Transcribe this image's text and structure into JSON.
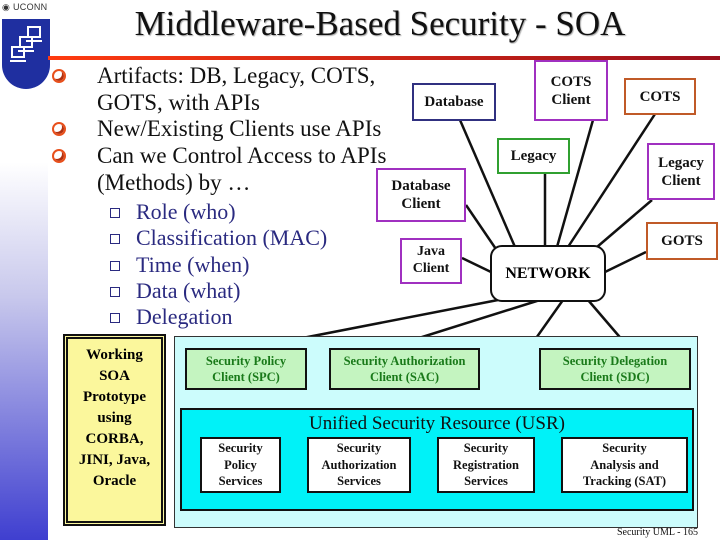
{
  "slide": {
    "title": "Middleware-Based Security - SOA",
    "logo_text": "UCONN",
    "footer": "Security UML - 165"
  },
  "bullets": [
    {
      "lines": [
        "Artifacts: DB, Legacy, COTS,",
        "GOTS, with APIs"
      ]
    },
    {
      "lines": [
        "New/Existing Clients use APIs"
      ]
    },
    {
      "lines": [
        "Can we Control Access to APIs",
        "(Methods) by …"
      ]
    }
  ],
  "sub_bullets": [
    "Role (who)",
    "Classification (MAC)",
    "Time (when)",
    "Data (what)",
    "Delegation"
  ],
  "network_diagram": {
    "center": "NETWORK",
    "nodes": [
      {
        "id": "database",
        "lines": [
          "Database"
        ],
        "color": "#303080"
      },
      {
        "id": "cots-client",
        "lines": [
          "COTS",
          "Client"
        ],
        "color": "#a030c0"
      },
      {
        "id": "cots",
        "lines": [
          "COTS"
        ],
        "color": "#c05a28"
      },
      {
        "id": "legacy",
        "lines": [
          "Legacy"
        ],
        "color": "#30a030"
      },
      {
        "id": "legacy-client",
        "lines": [
          "Legacy",
          "Client"
        ],
        "color": "#a030c0"
      },
      {
        "id": "database-client",
        "lines": [
          "Database",
          "Client"
        ],
        "color": "#a030c0"
      },
      {
        "id": "java-client",
        "lines": [
          "Java",
          "Client"
        ],
        "color": "#a030c0"
      },
      {
        "id": "gots",
        "lines": [
          "GOTS"
        ],
        "color": "#c05a28"
      }
    ]
  },
  "prototype_box": {
    "lines": [
      "Working",
      "SOA",
      "Prototype",
      "using",
      "CORBA,",
      "JINI, Java,",
      "Oracle"
    ]
  },
  "security_clients": [
    {
      "lines": [
        "Security Policy",
        "Client (SPC)"
      ]
    },
    {
      "lines": [
        "Security Authorization",
        "Client (SAC)"
      ]
    },
    {
      "lines": [
        "Security Delegation",
        "Client (SDC)"
      ]
    }
  ],
  "usr": {
    "title": "Unified Security Resource (USR)",
    "services": [
      {
        "lines": [
          "Security",
          "Policy",
          "Services"
        ]
      },
      {
        "lines": [
          "Security",
          "Authorization",
          "Services"
        ]
      },
      {
        "lines": [
          "Security",
          "Registration",
          "Services"
        ]
      },
      {
        "lines": [
          "Security",
          "Analysis and",
          "Tracking (SAT)"
        ]
      }
    ]
  }
}
